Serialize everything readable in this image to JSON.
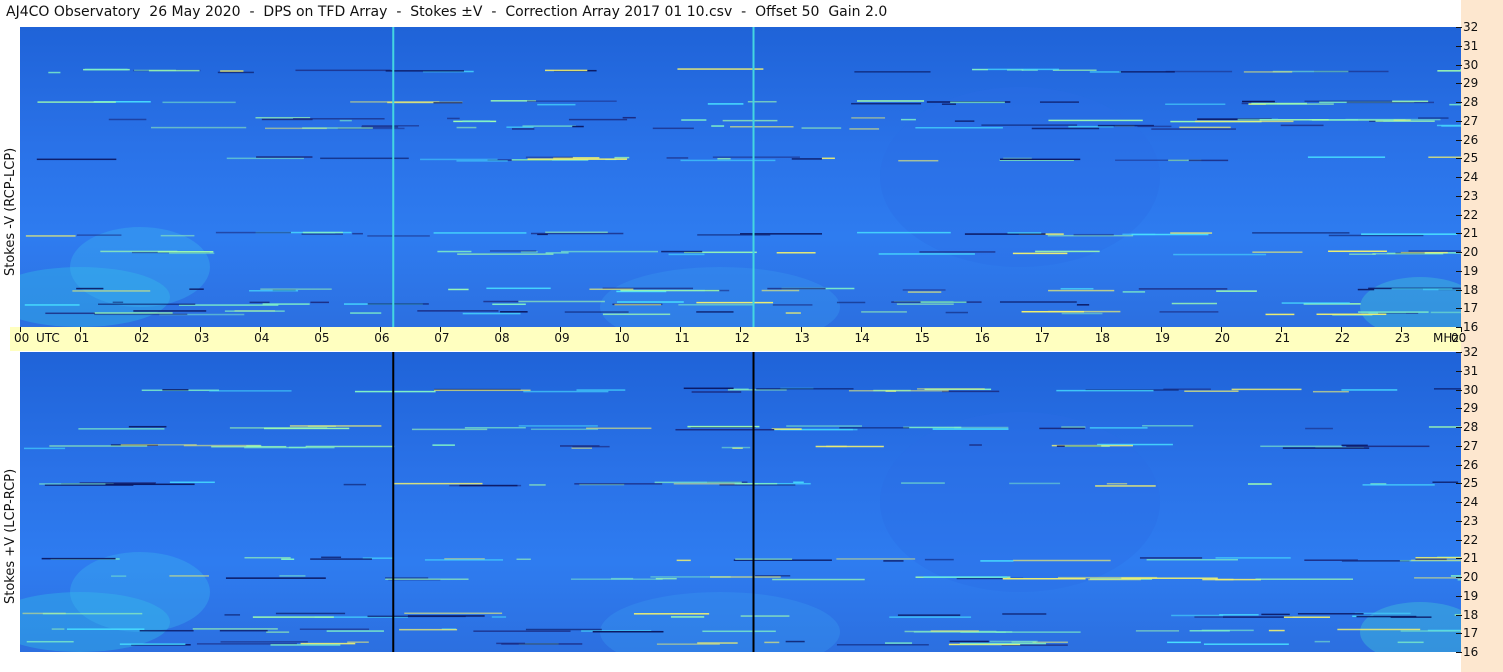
{
  "title": "AJ4CO Observatory  26 May 2020  -  DPS on TFD Array  -  Stokes ±V  -  Correction Array 2017 01 10.csv  -  Offset 50  Gain 2.0",
  "panels": [
    {
      "id": "top",
      "ylabel": "Stokes -V (RCP-LCP)"
    },
    {
      "id": "bottom",
      "ylabel": "Stokes +V (LCP-RCP)"
    }
  ],
  "time_axis": {
    "labels": [
      "00",
      "01",
      "02",
      "03",
      "04",
      "05",
      "06",
      "07",
      "08",
      "09",
      "10",
      "11",
      "12",
      "13",
      "14",
      "15",
      "16",
      "17",
      "18",
      "19",
      "20",
      "21",
      "22",
      "23",
      "00"
    ],
    "start_unit": "UTC",
    "end_unit": "MHz"
  },
  "freq_axis": {
    "labels": [
      "32",
      "31",
      "30",
      "29",
      "28",
      "27",
      "26",
      "25",
      "24",
      "23",
      "22",
      "21",
      "20",
      "19",
      "18",
      "17",
      "16"
    ]
  },
  "colors": {
    "background_blue": "#2a72e8",
    "time_bar": "#ffffc0",
    "right_strip": "#fde7cf",
    "marker_top": "#44d6e0",
    "marker_bottom": "#000000"
  },
  "chart_data": {
    "type": "heatmap",
    "title": "AJ4CO Observatory  26 May 2020  -  DPS on TFD Array  -  Stokes ±V  -  Correction Array 2017 01 10.csv  -  Offset 50  Gain 2.0",
    "x": [
      "00",
      "01",
      "02",
      "03",
      "04",
      "05",
      "06",
      "07",
      "08",
      "09",
      "10",
      "11",
      "12",
      "13",
      "14",
      "15",
      "16",
      "17",
      "18",
      "19",
      "20",
      "21",
      "22",
      "23",
      "00"
    ],
    "xlabel": "UTC",
    "y": [
      32,
      31,
      30,
      29,
      28,
      27,
      26,
      25,
      24,
      23,
      22,
      21,
      20,
      19,
      18,
      17,
      16
    ],
    "ylabel": "MHz",
    "xlim": [
      0,
      24
    ],
    "ylim": [
      16,
      32
    ],
    "series": [
      {
        "name": "Stokes -V (RCP-LCP)",
        "vertical_markers_utc": [
          6.2,
          12.2
        ],
        "bright_bands_mhz": [
          16.8,
          17.3,
          18.0,
          20.0,
          21.0,
          25.0,
          26.7,
          27.1,
          28.0,
          29.7
        ]
      },
      {
        "name": "Stokes +V (LCP-RCP)",
        "vertical_markers_utc": [
          6.2,
          12.2
        ],
        "bright_bands_mhz": [
          16.5,
          17.2,
          18.0,
          20.0,
          21.0,
          25.0,
          27.0,
          28.0,
          30.0
        ]
      }
    ],
    "grid": false
  }
}
